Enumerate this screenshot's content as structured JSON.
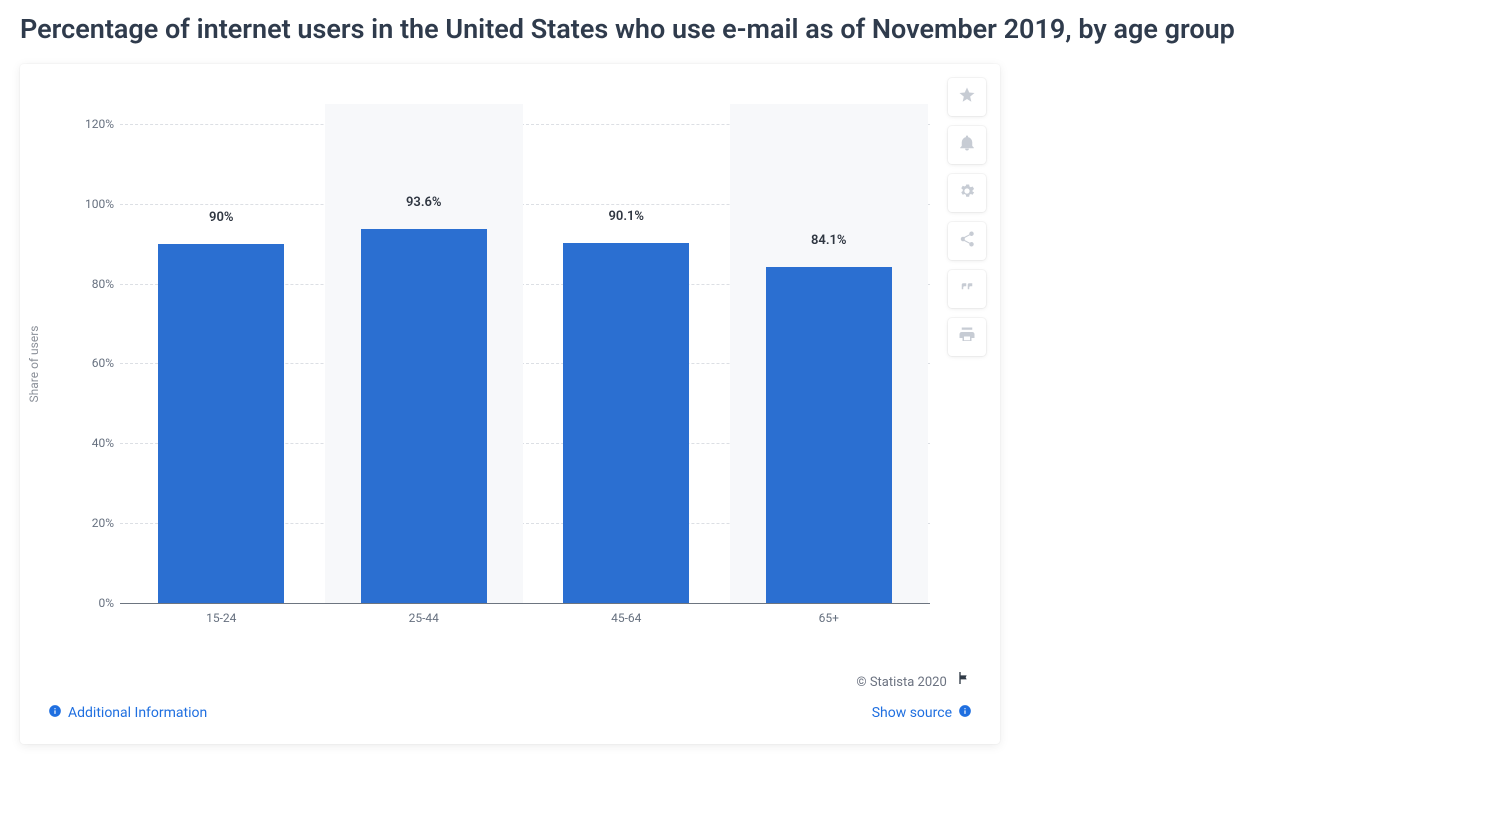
{
  "title": "Percentage of internet users in the United States who use e-mail as of November 2019, by age group",
  "chart_data": {
    "type": "bar",
    "categories": [
      "15-24",
      "25-44",
      "45-64",
      "65+"
    ],
    "values": [
      90,
      93.6,
      90.1,
      84.1
    ],
    "value_labels": [
      "90%",
      "93.6%",
      "90.1%",
      "84.1%"
    ],
    "ylabel": "Share of users",
    "xlabel": "",
    "ylim": [
      0,
      125
    ],
    "yticks": [
      0,
      20,
      40,
      60,
      80,
      100,
      120
    ],
    "ytick_labels": [
      "0%",
      "20%",
      "40%",
      "60%",
      "80%",
      "100%",
      "120%"
    ],
    "bar_color": "#2b6fd1"
  },
  "toolbar": {
    "favorite": "Favorite",
    "alert": "Alerts",
    "settings": "Settings",
    "share": "Share",
    "cite": "Cite",
    "print": "Print"
  },
  "footer": {
    "copyright": "© Statista 2020",
    "additional_info": "Additional Information",
    "show_source": "Show source"
  }
}
